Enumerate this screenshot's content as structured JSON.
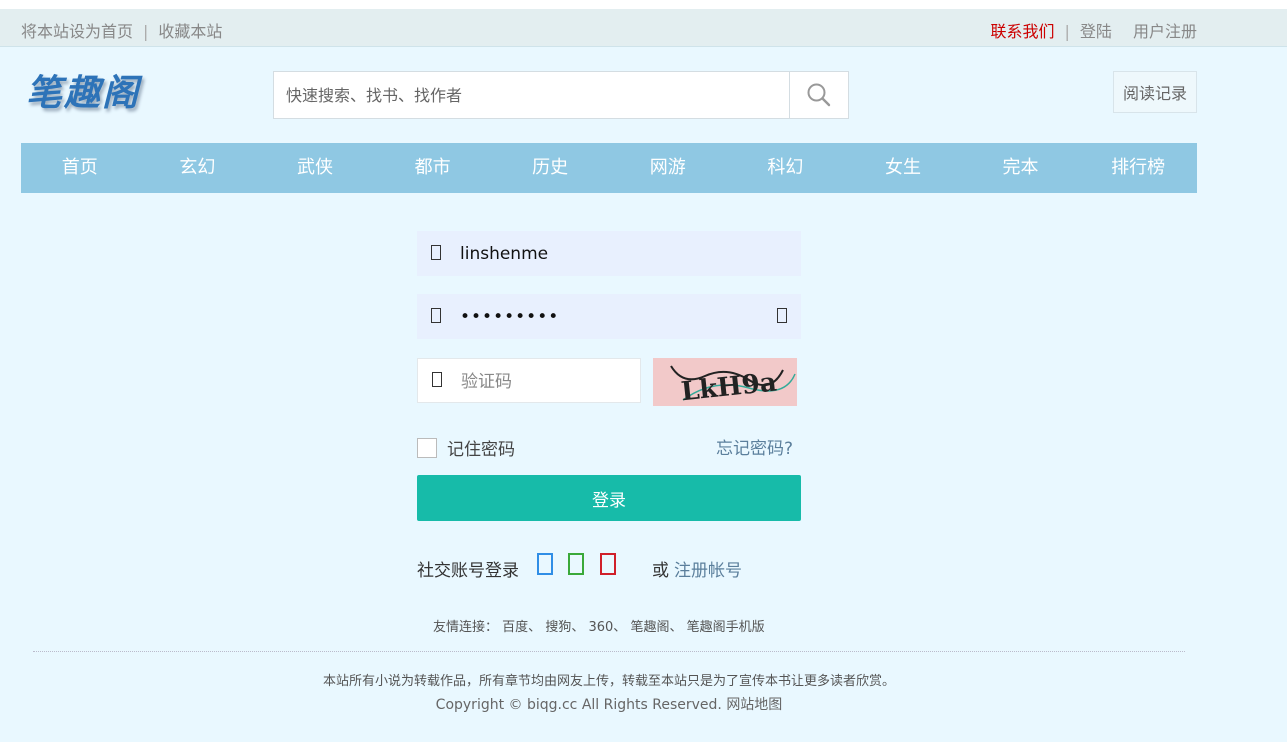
{
  "topbar": {
    "set_home": "将本站设为首页",
    "bookmark": "收藏本站",
    "contact": "联系我们",
    "login": "登陆",
    "register": "用户注册",
    "contact_color": "#cc0000"
  },
  "logo": {
    "text": "笔趣阁"
  },
  "search": {
    "placeholder": "快速搜索、找书、找作者",
    "icon": "search-icon"
  },
  "history_button": "阅读记录",
  "nav": {
    "items": [
      "首页",
      "玄幻",
      "武侠",
      "都市",
      "历史",
      "网游",
      "科幻",
      "女生",
      "完本",
      "排行榜"
    ],
    "bg_color": "#8fc8e3"
  },
  "login_form": {
    "username_value": "linshenme",
    "password_value": "•••••••••",
    "captcha_placeholder": "验证码",
    "captcha_text": "LkH9a",
    "remember_label": "记住密码",
    "forget_label": "忘记密码?",
    "submit_label": "登录",
    "submit_color": "#17bba9"
  },
  "social": {
    "label": "社交账号登录",
    "icons": [
      "qq-icon",
      "wechat-icon",
      "weibo-icon"
    ],
    "or_label": "或",
    "register_label": "注册帐号"
  },
  "footer": {
    "links_label": "友情连接：",
    "links": [
      "百度",
      "搜狗",
      "360",
      "笔趣阁",
      "笔趣阁手机版"
    ],
    "disclaimer": "本站所有小说为转载作品，所有章节均由网友上传，转载至本站只是为了宣传本书让更多读者欣赏。",
    "copyright": "Copyright © biqg.cc All Rights Reserved.",
    "sitemap": "网站地图"
  }
}
